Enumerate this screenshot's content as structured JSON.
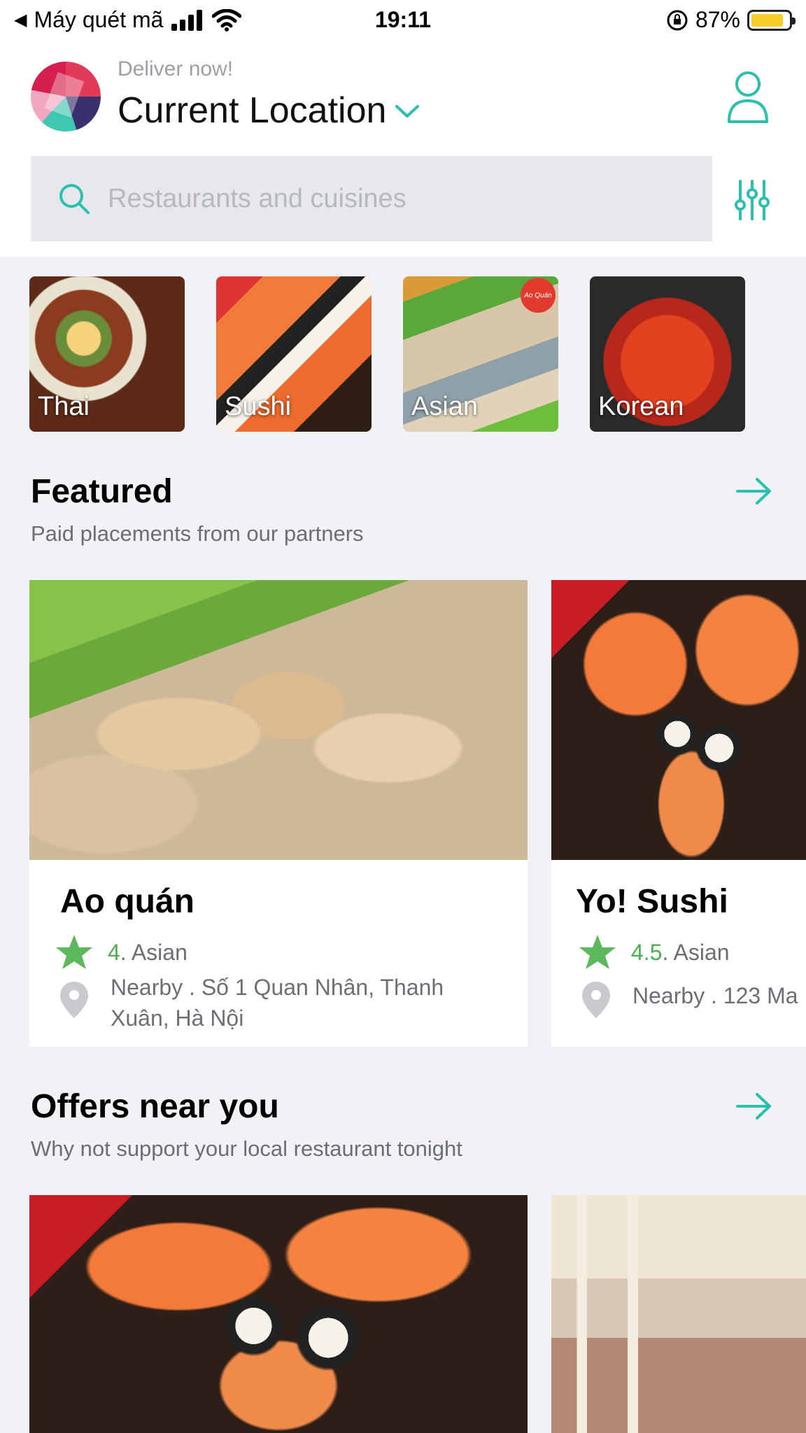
{
  "status_bar": {
    "back_app": "Máy quét mã",
    "time": "19:11",
    "battery": "87%",
    "battery_level": 0.87
  },
  "header": {
    "deliver_label": "Deliver now!",
    "location": "Current Location",
    "search_placeholder": "Restaurants and cuisines"
  },
  "categories": [
    {
      "label": "Thai"
    },
    {
      "label": "Sushi"
    },
    {
      "label": "Asian",
      "badge": "Ao Quán"
    },
    {
      "label": "Korean"
    }
  ],
  "featured": {
    "title": "Featured",
    "subtitle": "Paid placements from our partners",
    "cards": [
      {
        "name": "Ao quán",
        "rating": "4",
        "cuisine": " . Asian",
        "address": "Nearby .  Số 1 Quan Nhân, Thanh Xuân, Hà Nội"
      },
      {
        "name": "Yo! Sushi",
        "rating": "4.5",
        "cuisine": " . Asian",
        "address": "Nearby . 123 Ma"
      }
    ]
  },
  "offers": {
    "title": "Offers near you",
    "subtitle": "Why not support your local restaurant tonight"
  },
  "colors": {
    "accent": "#2bbfae",
    "rating_green": "#4caf50",
    "search_bg": "#e6e8ec"
  }
}
